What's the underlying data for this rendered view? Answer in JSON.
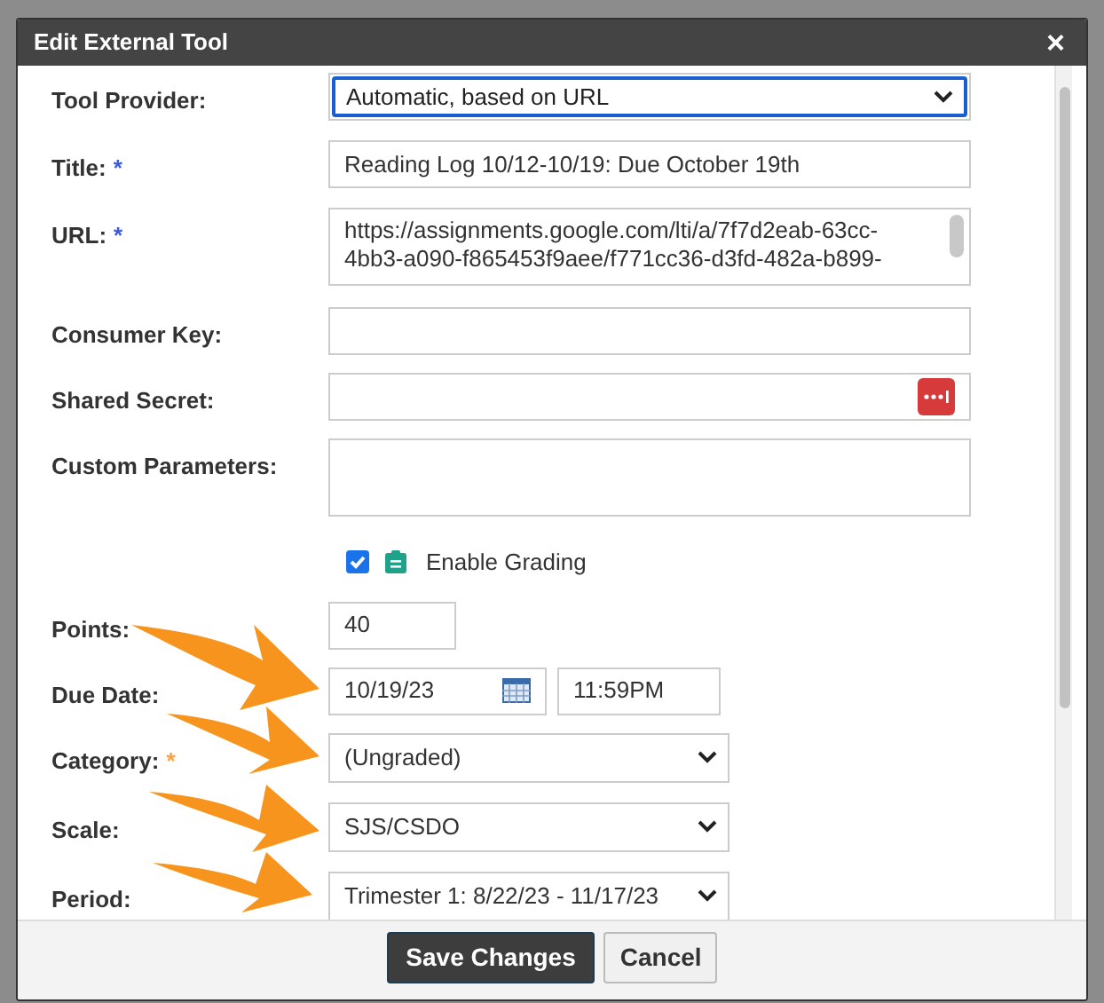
{
  "dialog": {
    "title": "Edit External Tool",
    "close": "×"
  },
  "form": {
    "tool_provider": {
      "label": "Tool Provider:",
      "value": "Automatic, based on URL",
      "focused": true
    },
    "title": {
      "label": "Title:",
      "required_mark": "*",
      "value": "Reading Log 10/12-10/19: Due October 19th"
    },
    "url": {
      "label": "URL:",
      "required_mark": "*",
      "value_lines": [
        "https://assignments.google.com/lti/a/7f7d2eab-63cc-",
        "4bb3-a090-f865453f9aee/f771cc36-d3fd-482a-b899-"
      ]
    },
    "consumer_key": {
      "label": "Consumer Key:"
    },
    "shared_secret": {
      "label": "Shared Secret:"
    },
    "custom_parameters": {
      "label": "Custom Parameters:"
    },
    "enable_grading": {
      "label": "Enable Grading",
      "checked": true
    },
    "points": {
      "label": "Points:",
      "value": "40"
    },
    "due_date": {
      "label": "Due Date:",
      "date": "10/19/23",
      "time": "11:59PM"
    },
    "category": {
      "label": "Category:",
      "required_mark": "*",
      "value": "(Ungraded)"
    },
    "scale": {
      "label": "Scale:",
      "value": "SJS/CSDO"
    },
    "period": {
      "label": "Period:",
      "value": "Trimester 1: 8/22/23 - 11/17/23"
    }
  },
  "buttons": [
    {
      "label": "Save Changes",
      "primary": true
    },
    {
      "label": "Cancel",
      "primary": false
    }
  ]
}
